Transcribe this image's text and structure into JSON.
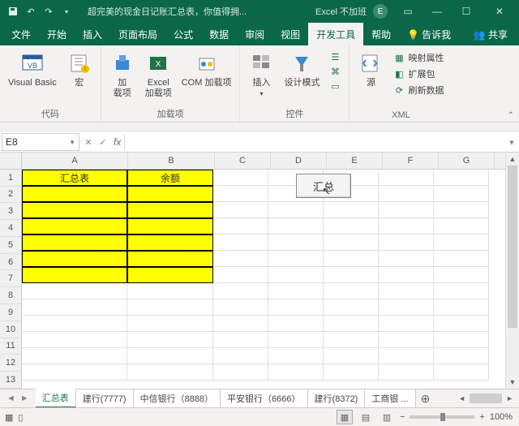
{
  "titlebar": {
    "doc_title": "超完美的现金日记账汇总表，你值得拥...",
    "app_name": "Excel 不加班",
    "user_initial": "E"
  },
  "menu": {
    "file": "文件",
    "home": "开始",
    "insert": "插入",
    "layout": "页面布局",
    "formulas": "公式",
    "data": "数据",
    "review": "审阅",
    "view": "视图",
    "developer": "开发工具",
    "help": "帮助",
    "tellme": "告诉我",
    "share": "共享"
  },
  "ribbon": {
    "code_group": "代码",
    "vb": "Visual Basic",
    "macros": "宏",
    "addins_group": "加载项",
    "addins": "加\n载项",
    "excel_addins": "Excel\n加载项",
    "com_addins": "COM 加载项",
    "controls_group": "控件",
    "insert_ctrl": "插入",
    "design_mode": "设计模式",
    "xml_group": "XML",
    "source": "源",
    "map_props": "映射属性",
    "expansion": "扩展包",
    "refresh": "刷新数据"
  },
  "formula_bar": {
    "namebox": "E8"
  },
  "columns": [
    "A",
    "B",
    "C",
    "D",
    "E",
    "F",
    "G"
  ],
  "rows": [
    "1",
    "2",
    "3",
    "4",
    "5",
    "6",
    "7",
    "8",
    "9",
    "10",
    "11",
    "12",
    "13"
  ],
  "cells": {
    "A1": "汇总表",
    "B1": "余额"
  },
  "sheet_button": "汇总",
  "sheet_tabs": {
    "active": "汇总表",
    "t2": "建行(7777)",
    "t3": "中信银行（8888）",
    "t4": "平安银行（6666）",
    "t5": "建行(8372)",
    "t6": "工商银 ..."
  },
  "status": {
    "zoom": "100%",
    "minus": "−",
    "plus": "+"
  }
}
